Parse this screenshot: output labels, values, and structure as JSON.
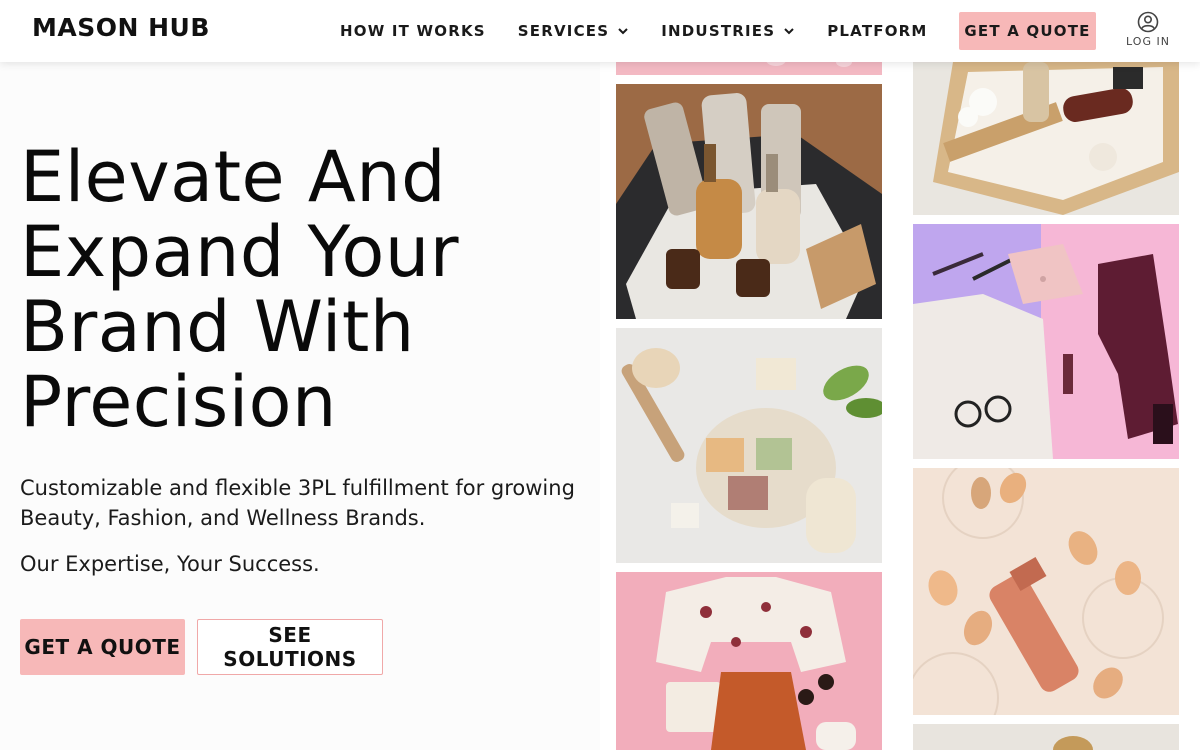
{
  "brand": {
    "logo": "MASON HUB"
  },
  "nav": {
    "items": [
      {
        "label": "HOW IT WORKS",
        "dropdown": false
      },
      {
        "label": "SERVICES",
        "dropdown": true
      },
      {
        "label": "INDUSTRIES",
        "dropdown": true
      },
      {
        "label": "PLATFORM",
        "dropdown": false
      }
    ],
    "cta_label": "GET A QUOTE",
    "login_label": "LOG IN"
  },
  "hero": {
    "headline": "Elevate And Expand Your Brand With Precision",
    "subheadline": "Customizable and flexible 3PL fulfillment for growing Beauty, Fashion, and Wellness Brands.",
    "tagline": "Our Expertise, Your Success.",
    "primary_button": "GET A QUOTE",
    "secondary_button": "SEE SOLUTIONS"
  },
  "gallery": {
    "images": [
      {
        "name": "pink-product-top"
      },
      {
        "name": "serum-bottles-box"
      },
      {
        "name": "soap-bars-brush"
      },
      {
        "name": "floral-outfit-flatlay"
      },
      {
        "name": "cotton-comb-gift-box"
      },
      {
        "name": "fashion-accessories-flatlay"
      },
      {
        "name": "makeup-sponges-bottle"
      },
      {
        "name": "bottom-product-peek"
      }
    ]
  },
  "colors": {
    "accent": "#f7b8b8",
    "text": "#0c0c0c",
    "background": "#ffffff"
  }
}
